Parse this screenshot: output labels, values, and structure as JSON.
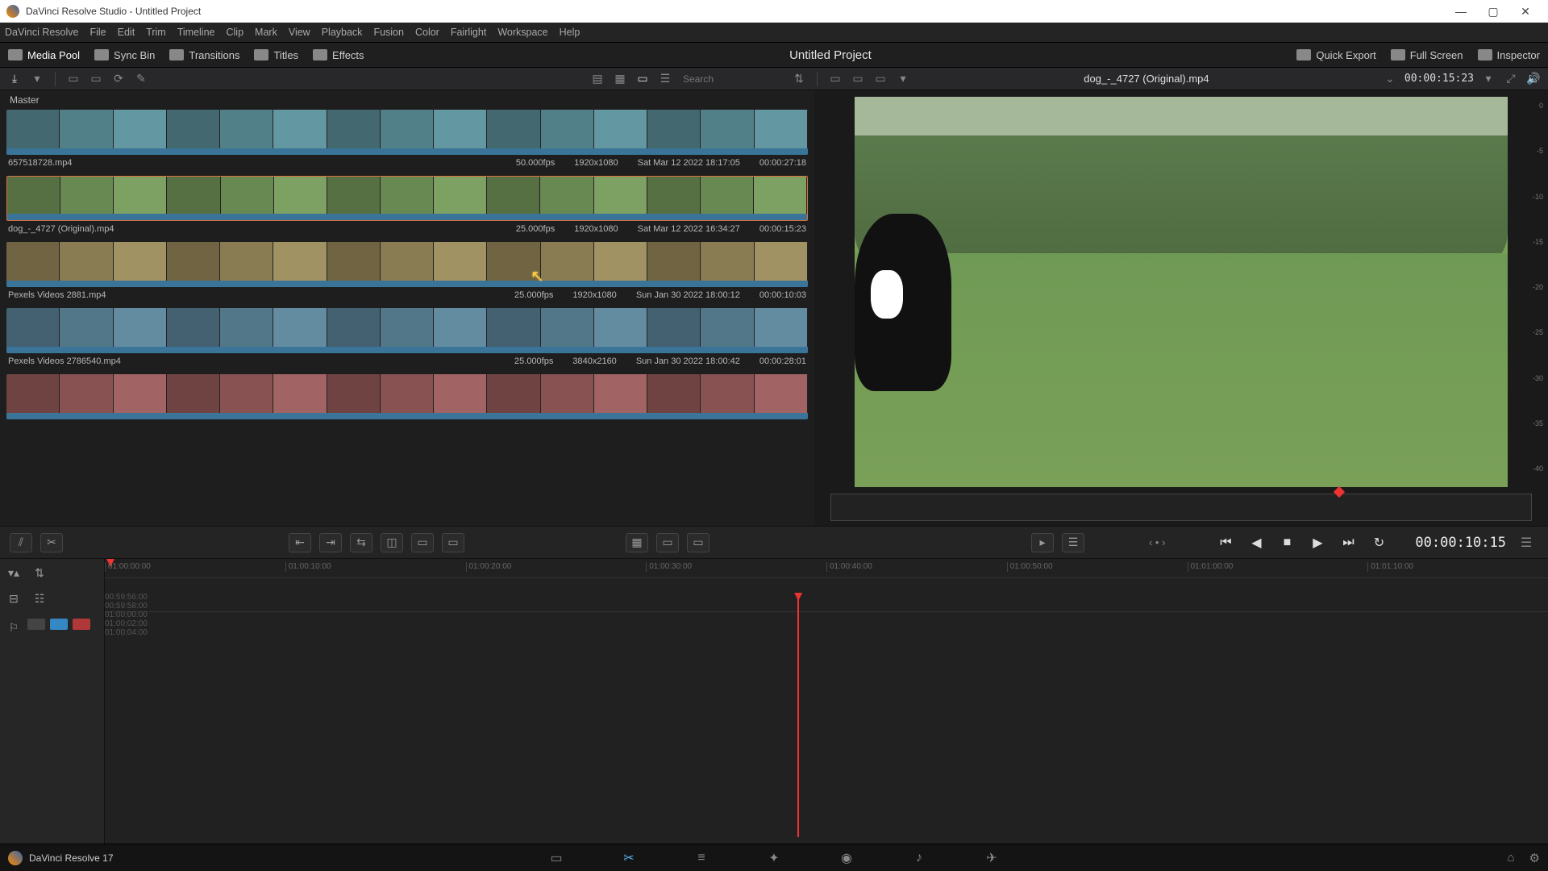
{
  "window": {
    "title": "DaVinci Resolve Studio - Untitled Project"
  },
  "menu": [
    "DaVinci Resolve",
    "File",
    "Edit",
    "Trim",
    "Timeline",
    "Clip",
    "Mark",
    "View",
    "Playback",
    "Fusion",
    "Color",
    "Fairlight",
    "Workspace",
    "Help"
  ],
  "toolbar": {
    "items": [
      {
        "label": "Media Pool",
        "active": true
      },
      {
        "label": "Sync Bin",
        "active": false
      },
      {
        "label": "Transitions",
        "active": false
      },
      {
        "label": "Titles",
        "active": false
      },
      {
        "label": "Effects",
        "active": false
      }
    ],
    "project_title": "Untitled Project",
    "right": [
      "Quick Export",
      "Full Screen",
      "Inspector"
    ]
  },
  "subtoolbar": {
    "search_placeholder": "Search",
    "viewer_clip": "dog_-_4727 (Original).mp4",
    "viewer_tc": "00:00:15:23"
  },
  "media": {
    "crumb": "Master",
    "clips": [
      {
        "name": "657518728.mp4",
        "fps": "50.000fps",
        "res": "1920x1080",
        "date": "Sat Mar 12 2022 18:17:05",
        "dur": "00:00:27:18",
        "hue": 190,
        "selected": false
      },
      {
        "name": "dog_-_4727 (Original).mp4",
        "fps": "25.000fps",
        "res": "1920x1080",
        "date": "Sat Mar 12 2022 16:34:27",
        "dur": "00:00:15:23",
        "hue": 95,
        "selected": true
      },
      {
        "name": "Pexels Videos 2881.mp4",
        "fps": "25.000fps",
        "res": "1920x1080",
        "date": "Sun Jan 30 2022 18:00:12",
        "dur": "00:00:10:03",
        "hue": 45,
        "selected": false
      },
      {
        "name": "Pexels Videos 2786540.mp4",
        "fps": "25.000fps",
        "res": "3840x2160",
        "date": "Sun Jan 30 2022 18:00:42",
        "dur": "00:00:28:01",
        "hue": 200,
        "selected": false
      },
      {
        "name": "",
        "fps": "",
        "res": "",
        "date": "",
        "dur": "",
        "hue": 0,
        "selected": false
      }
    ]
  },
  "audiolevels": [
    "0",
    "-5",
    "-10",
    "-15",
    "-20",
    "-25",
    "-30",
    "-35",
    "-40"
  ],
  "transport": {
    "timecode": "00:00:10:15"
  },
  "ruler1": [
    "01:00:00:00",
    "01:00:10:00",
    "01:00:20:00",
    "01:00:30:00",
    "01:00:40:00",
    "01:00:50:00",
    "01:01:00:00",
    "01:01:10:00"
  ],
  "ruler2": [
    "00:59:56:00",
    "00:59:58:00",
    "01:00:00:00",
    "01:00:02:00",
    "01:00:04:00"
  ],
  "footer": {
    "app": "DaVinci Resolve 17",
    "pages": [
      "media",
      "cut",
      "edit",
      "fusion",
      "color",
      "fairlight",
      "deliver"
    ]
  }
}
